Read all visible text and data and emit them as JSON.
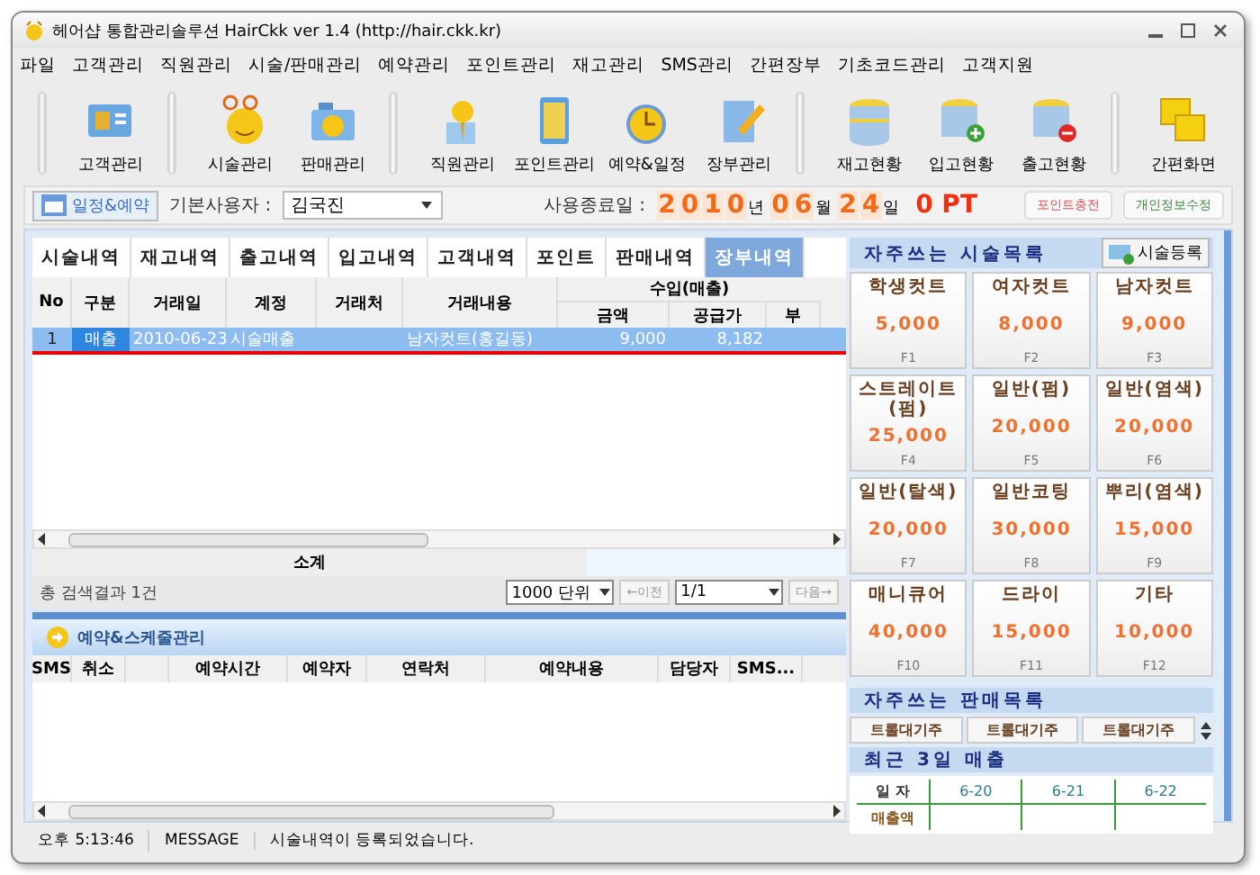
{
  "window": {
    "title": "헤어샵 통합관리솔루션 HairCkk ver 1.4 (http://hair.ckk.kr)"
  },
  "menu": [
    "파일",
    "고객관리",
    "직원관리",
    "시술/판매관리",
    "예약관리",
    "포인트관리",
    "재고관리",
    "SMS관리",
    "간편장부",
    "기초코드관리",
    "고객지원"
  ],
  "toolbar": [
    {
      "label": "고객관리",
      "group_start": true
    },
    {
      "label": "시술관리",
      "group_start": true
    },
    {
      "label": "판매관리",
      "group_start": false
    },
    {
      "label": "직원관리",
      "group_start": true
    },
    {
      "label": "포인트관리",
      "group_start": false
    },
    {
      "label": "예약&일정",
      "group_start": false
    },
    {
      "label": "장부관리",
      "group_start": false
    },
    {
      "label": "재고현황",
      "group_start": true
    },
    {
      "label": "입고현황",
      "group_start": false
    },
    {
      "label": "출고현황",
      "group_start": false
    },
    {
      "label": "간편화면",
      "group_start": true
    }
  ],
  "info_bar": {
    "schedule_button": "일정&예약",
    "user_label": "기본사용자 :",
    "user": "김국진",
    "expiry_label": "사용종료일 :",
    "year": "2010",
    "year_unit": "년",
    "month": "06",
    "month_unit": "월",
    "day": "24",
    "day_unit": "일",
    "points": "0 PT",
    "charge_button": "포인트충전",
    "profile_button": "개인정보수정"
  },
  "tabs": [
    {
      "label": "시술내역",
      "selected": false
    },
    {
      "label": "재고내역",
      "selected": false
    },
    {
      "label": "출고내역",
      "selected": false
    },
    {
      "label": "입고내역",
      "selected": false
    },
    {
      "label": "고객내역",
      "selected": false
    },
    {
      "label": "포인트",
      "selected": false
    },
    {
      "label": "판매내역",
      "selected": false
    },
    {
      "label": "장부내역",
      "selected": true
    }
  ],
  "ledger": {
    "columns": [
      "No",
      "구분",
      "거래일",
      "계정",
      "거래처",
      "거래내용"
    ],
    "group": "수입(매출)",
    "sub_columns": [
      "금액",
      "공급가",
      "부"
    ],
    "rows": [
      {
        "cells": [
          "1",
          "매출",
          "2010-06-23",
          "시술매출",
          "",
          "남자컷트(홍길동)",
          "9,000",
          "8,182"
        ],
        "selected": true
      }
    ],
    "subtotal": "소계",
    "result": "총 검색결과 1건",
    "unit": "1000 단위",
    "prev": "←이전",
    "page": "1/1",
    "next": "다음→"
  },
  "schedule": {
    "title": "예약&스케줄관리",
    "columns": [
      "SMS",
      "취소",
      "",
      "예약시간",
      "예약자",
      "연락처",
      "예약내용",
      "담당자",
      "SMS..."
    ]
  },
  "status_bar": {
    "time": "오후 5:13:46",
    "label": "MESSAGE",
    "message": "시술내역이 등록되었습니다."
  },
  "services": {
    "title": "자주쓰는 시술목록",
    "add_button": "시술등록",
    "items": [
      {
        "name": "학생컷트",
        "price": "5,000",
        "key": "F1"
      },
      {
        "name": "여자컷트",
        "price": "8,000",
        "key": "F2"
      },
      {
        "name": "남자컷트",
        "price": "9,000",
        "key": "F3"
      },
      {
        "name": "스트레이트(펌)",
        "price": "25,000",
        "key": "F4"
      },
      {
        "name": "일반(펌)",
        "price": "20,000",
        "key": "F5"
      },
      {
        "name": "일반(염색)",
        "price": "20,000",
        "key": "F6"
      },
      {
        "name": "일반(탈색)",
        "price": "20,000",
        "key": "F7"
      },
      {
        "name": "일반코팅",
        "price": "30,000",
        "key": "F8"
      },
      {
        "name": "뿌리(염색)",
        "price": "15,000",
        "key": "F9"
      },
      {
        "name": "매니큐어",
        "price": "40,000",
        "key": "F10"
      },
      {
        "name": "드라이",
        "price": "15,000",
        "key": "F11"
      },
      {
        "name": "기타",
        "price": "10,000",
        "key": "F12"
      }
    ]
  },
  "products": {
    "title": "자주쓰는 판매목록",
    "items": [
      "트롤대기주",
      "트롤대기주",
      "트롤대기주"
    ]
  },
  "recent_sales": {
    "title": "최근 3일 매출",
    "date_label": "일 자",
    "amount_label": "매출액",
    "dates": [
      "6-20",
      "6-21",
      "6-22"
    ]
  }
}
